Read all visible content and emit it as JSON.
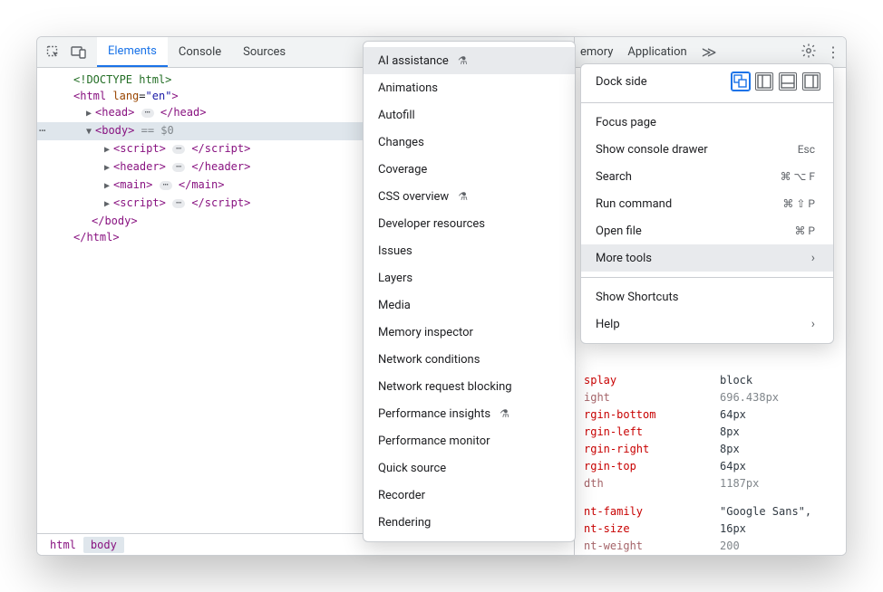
{
  "tabs": {
    "elements": "Elements",
    "console": "Console",
    "sources": "Sources",
    "memory_partial": "emory",
    "application": "Application"
  },
  "dom": {
    "doctype": "<!DOCTYPE html>",
    "html_open_tag": "html",
    "html_lang_attr": "lang",
    "html_lang_val": "\"en\"",
    "head": "head",
    "body": "body",
    "script": "script",
    "header": "header",
    "main": "main",
    "selected_suffix": "== $0"
  },
  "breadcrumb": {
    "html": "html",
    "body": "body"
  },
  "more_tools": {
    "items": [
      "AI assistance",
      "Animations",
      "Autofill",
      "Changes",
      "Coverage",
      "CSS overview",
      "Developer resources",
      "Issues",
      "Layers",
      "Media",
      "Memory inspector",
      "Network conditions",
      "Network request blocking",
      "Performance insights",
      "Performance monitor",
      "Quick source",
      "Recorder",
      "Rendering"
    ],
    "flask_indices": [
      0,
      5,
      13
    ]
  },
  "main_menu": {
    "dock_side": "Dock side",
    "focus_page": "Focus page",
    "show_console": "Show console drawer",
    "show_console_sc": "Esc",
    "search": "Search",
    "search_sc": "⌘ ⌥ F",
    "run_command": "Run command",
    "run_command_sc": "⌘ ⇧ P",
    "open_file": "Open file",
    "open_file_sc": "⌘ P",
    "more_tools": "More tools",
    "show_shortcuts": "Show Shortcuts",
    "help": "Help"
  },
  "styles": {
    "rows": [
      {
        "name": "splay",
        "value": "block",
        "gray": false
      },
      {
        "name": "ight",
        "value": "696.438px",
        "gray": true
      },
      {
        "name": "rgin-bottom",
        "value": "64px",
        "gray": false
      },
      {
        "name": "rgin-left",
        "value": "8px",
        "gray": false
      },
      {
        "name": "rgin-right",
        "value": "8px",
        "gray": false
      },
      {
        "name": "rgin-top",
        "value": "64px",
        "gray": false
      },
      {
        "name": "dth",
        "value": "1187px",
        "gray": true
      }
    ],
    "rows2": [
      {
        "name": "nt-family",
        "value": "\"Google Sans\",",
        "gray": false
      },
      {
        "name": "nt-size",
        "value": "16px",
        "gray": false
      },
      {
        "name": "nt-weight",
        "value": "200",
        "gray": true
      }
    ]
  }
}
